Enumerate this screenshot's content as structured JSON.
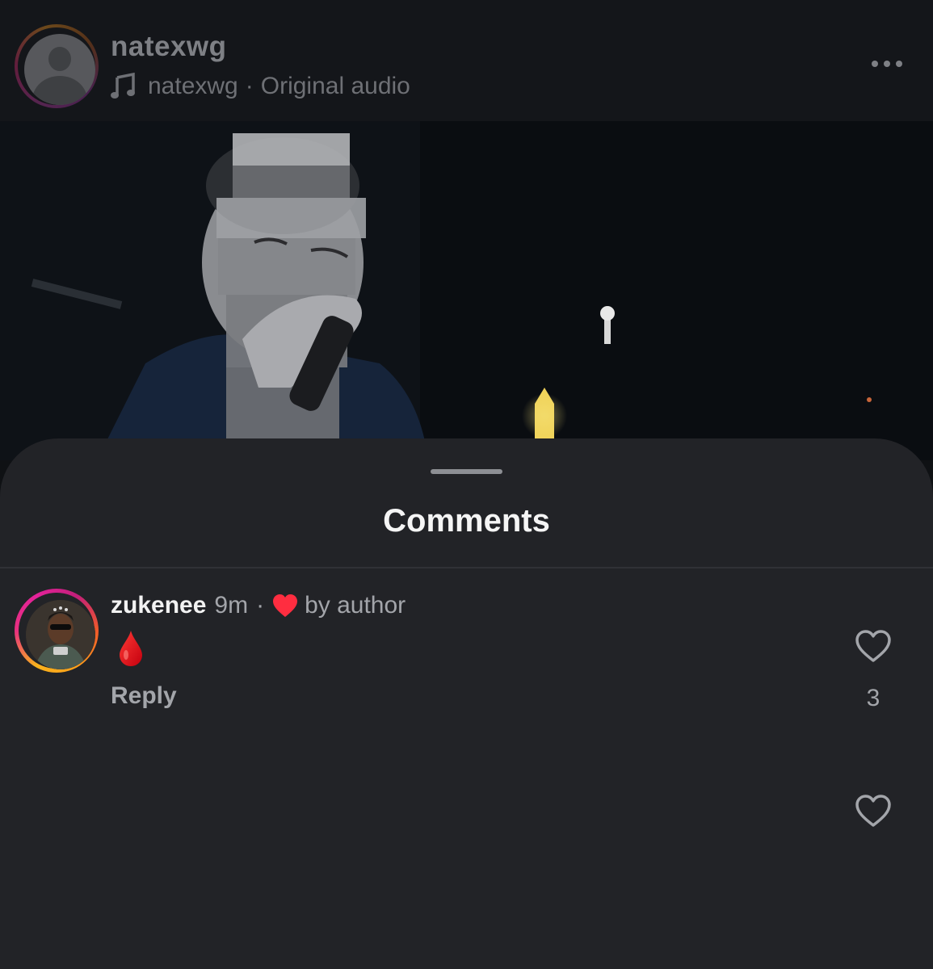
{
  "post": {
    "username": "natexwg",
    "audio_author": "natexwg",
    "audio_separator": "·",
    "audio_label": "Original audio",
    "icons": {
      "music": "music-note-icon",
      "more": "more-dots-icon"
    }
  },
  "sheet": {
    "title": "Comments"
  },
  "comments": [
    {
      "username": "zukenee",
      "time": "9m",
      "separator": "·",
      "liked_by_author_label": "by author",
      "body_icon": "drop-of-blood-emoji",
      "reply_label": "Reply",
      "like_count": "3"
    }
  ],
  "colors": {
    "sheet_bg": "#222327",
    "heart_red": "#ff2d40",
    "text_primary": "#f2f2f2",
    "text_secondary": "#a3a5aa"
  }
}
